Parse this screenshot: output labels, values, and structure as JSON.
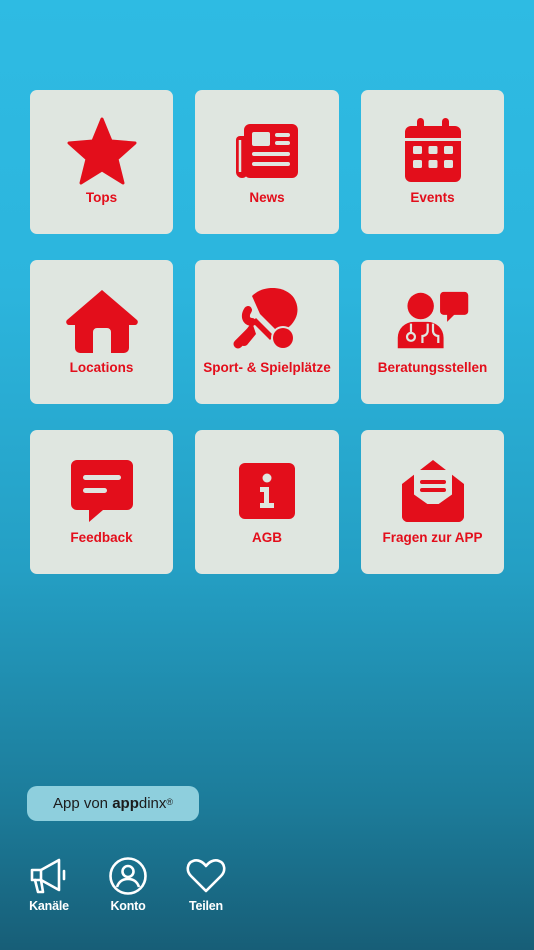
{
  "colors": {
    "accent": "#e30e1b",
    "tile_bg": "#dfe6e0",
    "bg_top": "#2ebbe3",
    "bg_bottom": "#175e77"
  },
  "tiles": [
    {
      "label": "Tops",
      "icon": "star-icon"
    },
    {
      "label": "News",
      "icon": "newspaper-icon"
    },
    {
      "label": "Events",
      "icon": "calendar-icon"
    },
    {
      "label": "Locations",
      "icon": "house-icon"
    },
    {
      "label": "Sport- & Spielplätze",
      "icon": "table-tennis-icon"
    },
    {
      "label": "Beratungsstellen",
      "icon": "doctor-chat-icon"
    },
    {
      "label": "Feedback",
      "icon": "message-icon"
    },
    {
      "label": "AGB",
      "icon": "info-icon"
    },
    {
      "label": "Fragen zur APP",
      "icon": "envelope-open-icon"
    }
  ],
  "badge": {
    "prefix": "App von ",
    "brand_bold": "app",
    "brand_rest": "dinx",
    "reg": "®"
  },
  "nav": [
    {
      "label": "Kanäle",
      "icon": "megaphone-icon"
    },
    {
      "label": "Konto",
      "icon": "user-circle-icon"
    },
    {
      "label": "Teilen",
      "icon": "heart-icon"
    }
  ]
}
